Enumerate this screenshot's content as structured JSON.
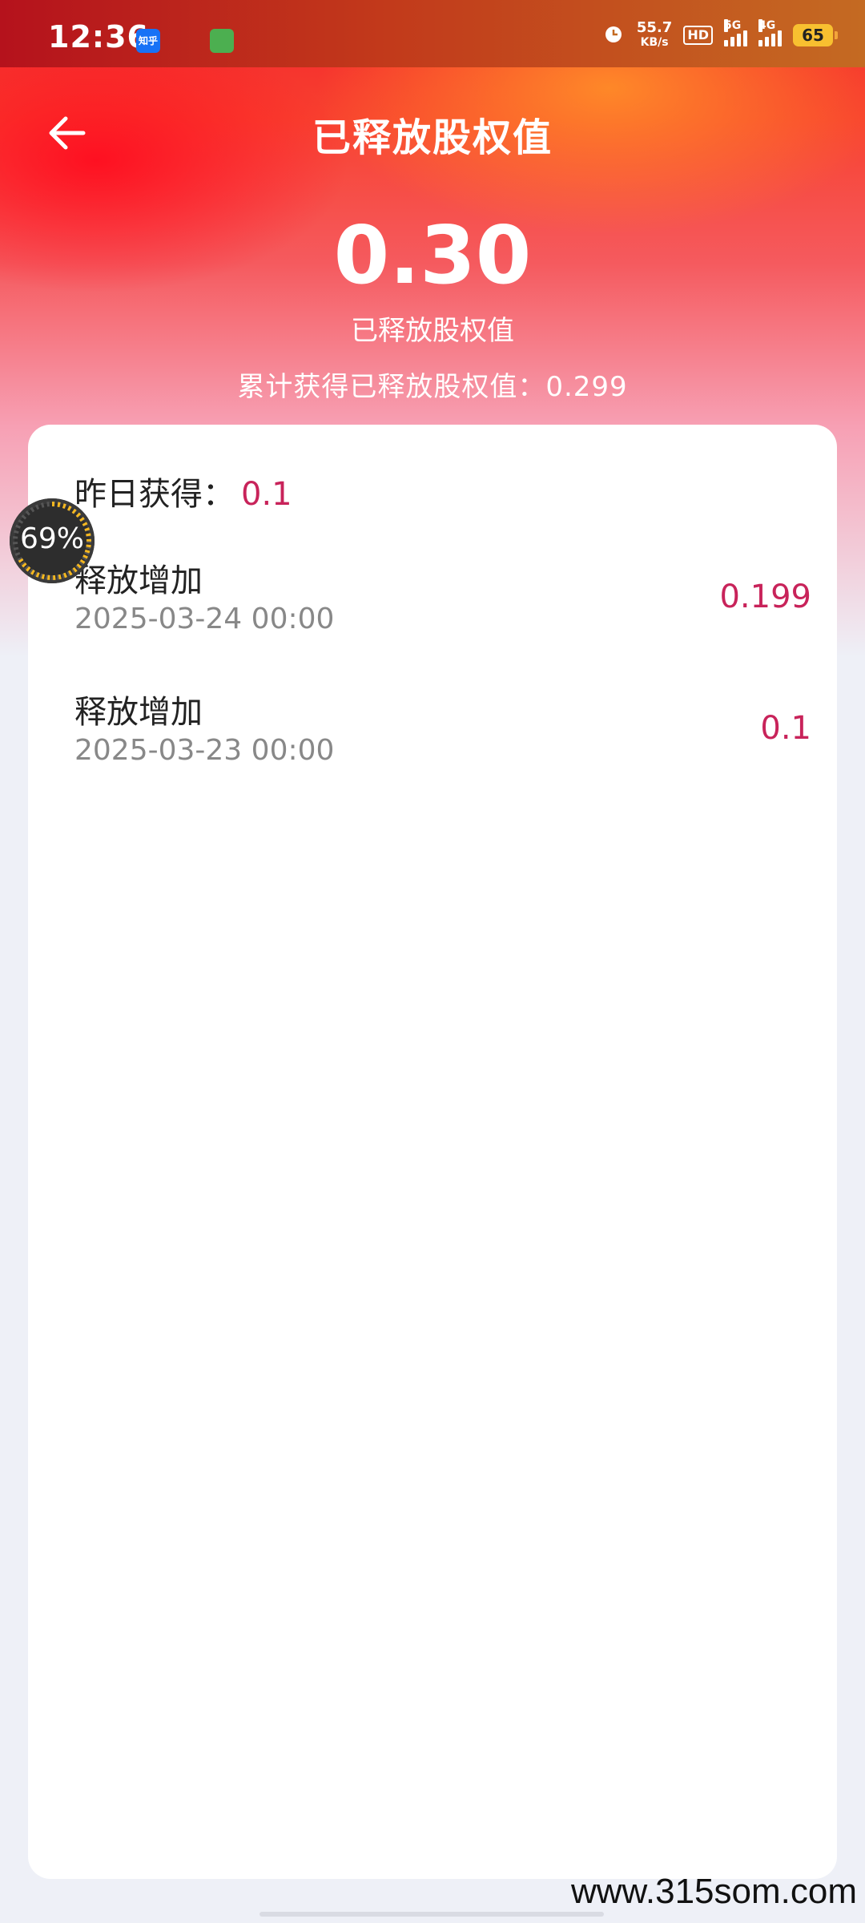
{
  "status_bar": {
    "time": "12:36",
    "app_icons": [
      "知乎",
      "shield",
      "app"
    ],
    "net_speed_value": "55.7",
    "net_speed_unit": "KB/s",
    "hd_label": "HD",
    "sim1": "5G",
    "sim2": "4G",
    "battery": "65"
  },
  "header": {
    "title": "已释放股权值"
  },
  "summary": {
    "value": "0.30",
    "label": "已释放股权值",
    "total_text": "累计获得已释放股权值：0.299"
  },
  "card": {
    "yesterday_label": "昨日获得：",
    "yesterday_value": "0.1",
    "records": [
      {
        "name": "释放增加",
        "date": "2025-03-24 00:00",
        "amount": "0.199"
      },
      {
        "name": "释放增加",
        "date": "2025-03-23 00:00",
        "amount": "0.1"
      }
    ]
  },
  "floating_ball": {
    "percent": "69%"
  },
  "watermark": "www.315som.com",
  "colors": {
    "accent": "#c8235a",
    "hero_red": "#f2232d",
    "hero_orange": "#ff8c28"
  }
}
